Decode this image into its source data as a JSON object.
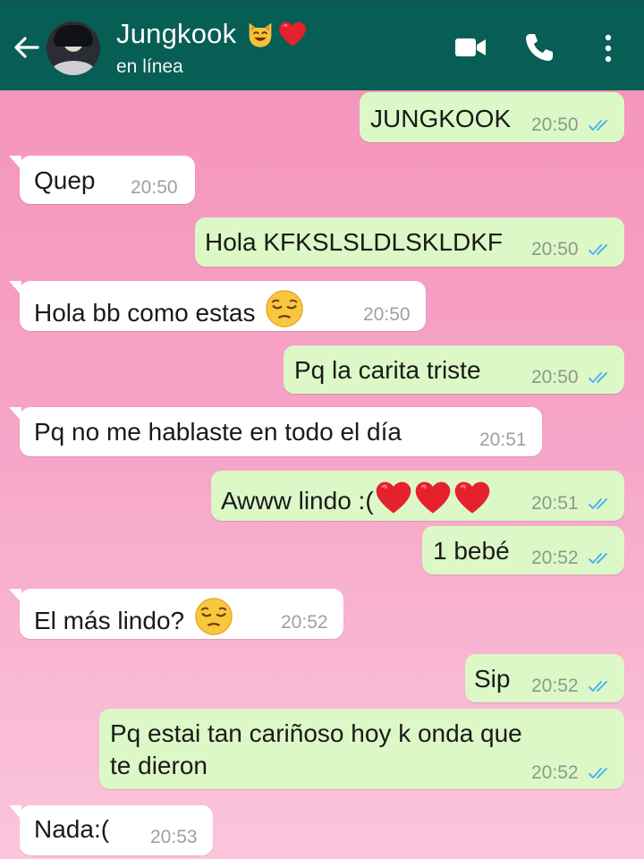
{
  "header": {
    "back_icon": "arrow-left-icon",
    "contact_name": "Jungkook",
    "name_emojis": [
      "cat-face-emoji",
      "red-heart-emoji"
    ],
    "status": "en línea",
    "actions": [
      "video-call-icon",
      "phone-icon",
      "more-vert-icon"
    ]
  },
  "colors": {
    "header": "#075e54",
    "outgoing_bubble": "#dcf8c6",
    "incoming_bubble": "#ffffff",
    "read_ticks": "#4fb6ec"
  },
  "messages": [
    {
      "dir": "out",
      "text": "JUNGKOOK",
      "time": "20:50",
      "read": true
    },
    {
      "dir": "in",
      "text": "Quep",
      "time": "20:50"
    },
    {
      "dir": "out",
      "text": "Hola KFKSLSLDLSKLDKF",
      "time": "20:50",
      "read": true
    },
    {
      "dir": "in",
      "text": "Hola bb como estas",
      "emoji": "pensive-face-emoji",
      "time": "20:50"
    },
    {
      "dir": "out",
      "text": "Pq la carita triste",
      "time": "20:50",
      "read": true
    },
    {
      "dir": "in",
      "text": "Pq no me hablaste en todo el día",
      "time": "20:51"
    },
    {
      "dir": "out",
      "text": "Awww lindo :(",
      "emoji": "three-red-hearts-emoji",
      "time": "20:51",
      "read": true
    },
    {
      "dir": "out",
      "text": "1 bebé",
      "time": "20:52",
      "read": true
    },
    {
      "dir": "in",
      "text": "El más lindo?",
      "emoji": "pensive-face-emoji",
      "time": "20:52"
    },
    {
      "dir": "out",
      "text": "Sip",
      "time": "20:52",
      "read": true
    },
    {
      "dir": "out",
      "text_line1": "Pq estai tan cariñoso hoy k onda que",
      "text_line2": "te dieron",
      "time": "20:52",
      "read": true
    },
    {
      "dir": "in",
      "text": "Nada:(",
      "time": "20:53"
    }
  ]
}
